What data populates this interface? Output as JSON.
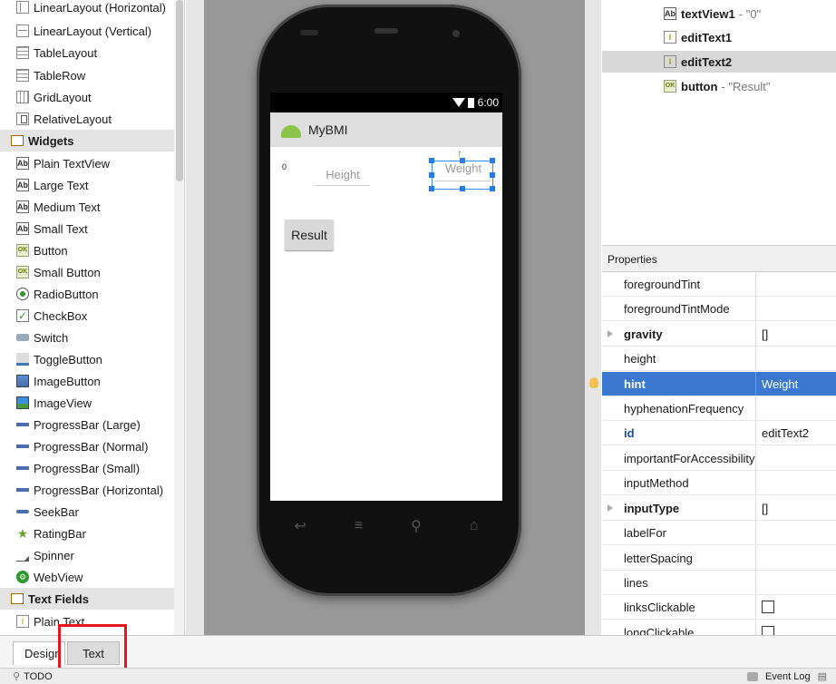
{
  "palette": {
    "layouts": [
      {
        "label": "LinearLayout (Horizontal)",
        "icon": "linear-layout-horizontal-icon"
      },
      {
        "label": "LinearLayout (Vertical)",
        "icon": "linear-layout-vertical-icon"
      },
      {
        "label": "TableLayout",
        "icon": "table-layout-icon"
      },
      {
        "label": "TableRow",
        "icon": "table-row-icon"
      },
      {
        "label": "GridLayout",
        "icon": "grid-layout-icon"
      },
      {
        "label": "RelativeLayout",
        "icon": "relative-layout-icon"
      }
    ],
    "widgets_category": "Widgets",
    "widgets": [
      {
        "label": "Plain TextView",
        "icon": "textview-icon"
      },
      {
        "label": "Large Text",
        "icon": "textview-icon"
      },
      {
        "label": "Medium Text",
        "icon": "textview-icon"
      },
      {
        "label": "Small Text",
        "icon": "textview-icon"
      },
      {
        "label": "Button",
        "icon": "button-icon"
      },
      {
        "label": "Small Button",
        "icon": "button-icon"
      },
      {
        "label": "RadioButton",
        "icon": "radio-button-icon"
      },
      {
        "label": "CheckBox",
        "icon": "checkbox-icon"
      },
      {
        "label": "Switch",
        "icon": "switch-icon"
      },
      {
        "label": "ToggleButton",
        "icon": "toggle-button-icon"
      },
      {
        "label": "ImageButton",
        "icon": "image-button-icon"
      },
      {
        "label": "ImageView",
        "icon": "image-view-icon"
      },
      {
        "label": "ProgressBar (Large)",
        "icon": "progress-bar-icon"
      },
      {
        "label": "ProgressBar (Normal)",
        "icon": "progress-bar-icon"
      },
      {
        "label": "ProgressBar (Small)",
        "icon": "progress-bar-icon"
      },
      {
        "label": "ProgressBar (Horizontal)",
        "icon": "progress-bar-icon"
      },
      {
        "label": "SeekBar",
        "icon": "seek-bar-icon"
      },
      {
        "label": "RatingBar",
        "icon": "rating-bar-icon"
      },
      {
        "label": "Spinner",
        "icon": "spinner-icon"
      },
      {
        "label": "WebView",
        "icon": "webview-icon"
      }
    ],
    "textfields_category": "Text Fields",
    "textfields": [
      {
        "label": "Plain Text",
        "icon": "text-field-icon"
      }
    ]
  },
  "device": {
    "time": "6:00",
    "app_title": "MyBMI",
    "textview_value": "0",
    "height_hint": "Height",
    "weight_hint": "Weight",
    "result_label": "Result"
  },
  "component_tree": [
    {
      "name": "textView1",
      "value": "- \"0\""
    },
    {
      "name": "editText1",
      "value": ""
    },
    {
      "name": "editText2",
      "value": ""
    },
    {
      "name": "button",
      "value": "- \"Result\""
    }
  ],
  "properties": {
    "header": "Properties",
    "rows": [
      {
        "name": "foregroundTint",
        "value": ""
      },
      {
        "name": "foregroundTintMode",
        "value": ""
      },
      {
        "name": "gravity",
        "value": "[]"
      },
      {
        "name": "height",
        "value": ""
      },
      {
        "name": "hint",
        "value": "Weight"
      },
      {
        "name": "hyphenationFrequency",
        "value": ""
      },
      {
        "name": "id",
        "value": "editText2"
      },
      {
        "name": "importantForAccessibility",
        "value": ""
      },
      {
        "name": "inputMethod",
        "value": ""
      },
      {
        "name": "inputType",
        "value": "[]"
      },
      {
        "name": "labelFor",
        "value": ""
      },
      {
        "name": "letterSpacing",
        "value": ""
      },
      {
        "name": "lines",
        "value": ""
      },
      {
        "name": "linksClickable",
        "value": ""
      },
      {
        "name": "longClickable",
        "value": ""
      }
    ]
  },
  "tabs": {
    "design": "Design",
    "text": "Text"
  },
  "statusbar": {
    "todo": "TODO",
    "event_log": "Event Log"
  }
}
